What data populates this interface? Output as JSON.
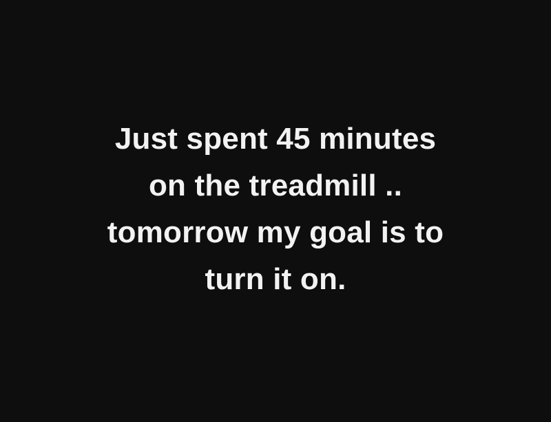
{
  "colors": {
    "background": "#0e0e0e",
    "text": "#f2f2f2"
  },
  "quote": {
    "lines": [
      "Just spent 45 minutes",
      "on the treadmill ..",
      "tomorrow my goal is to",
      "turn it on."
    ]
  }
}
